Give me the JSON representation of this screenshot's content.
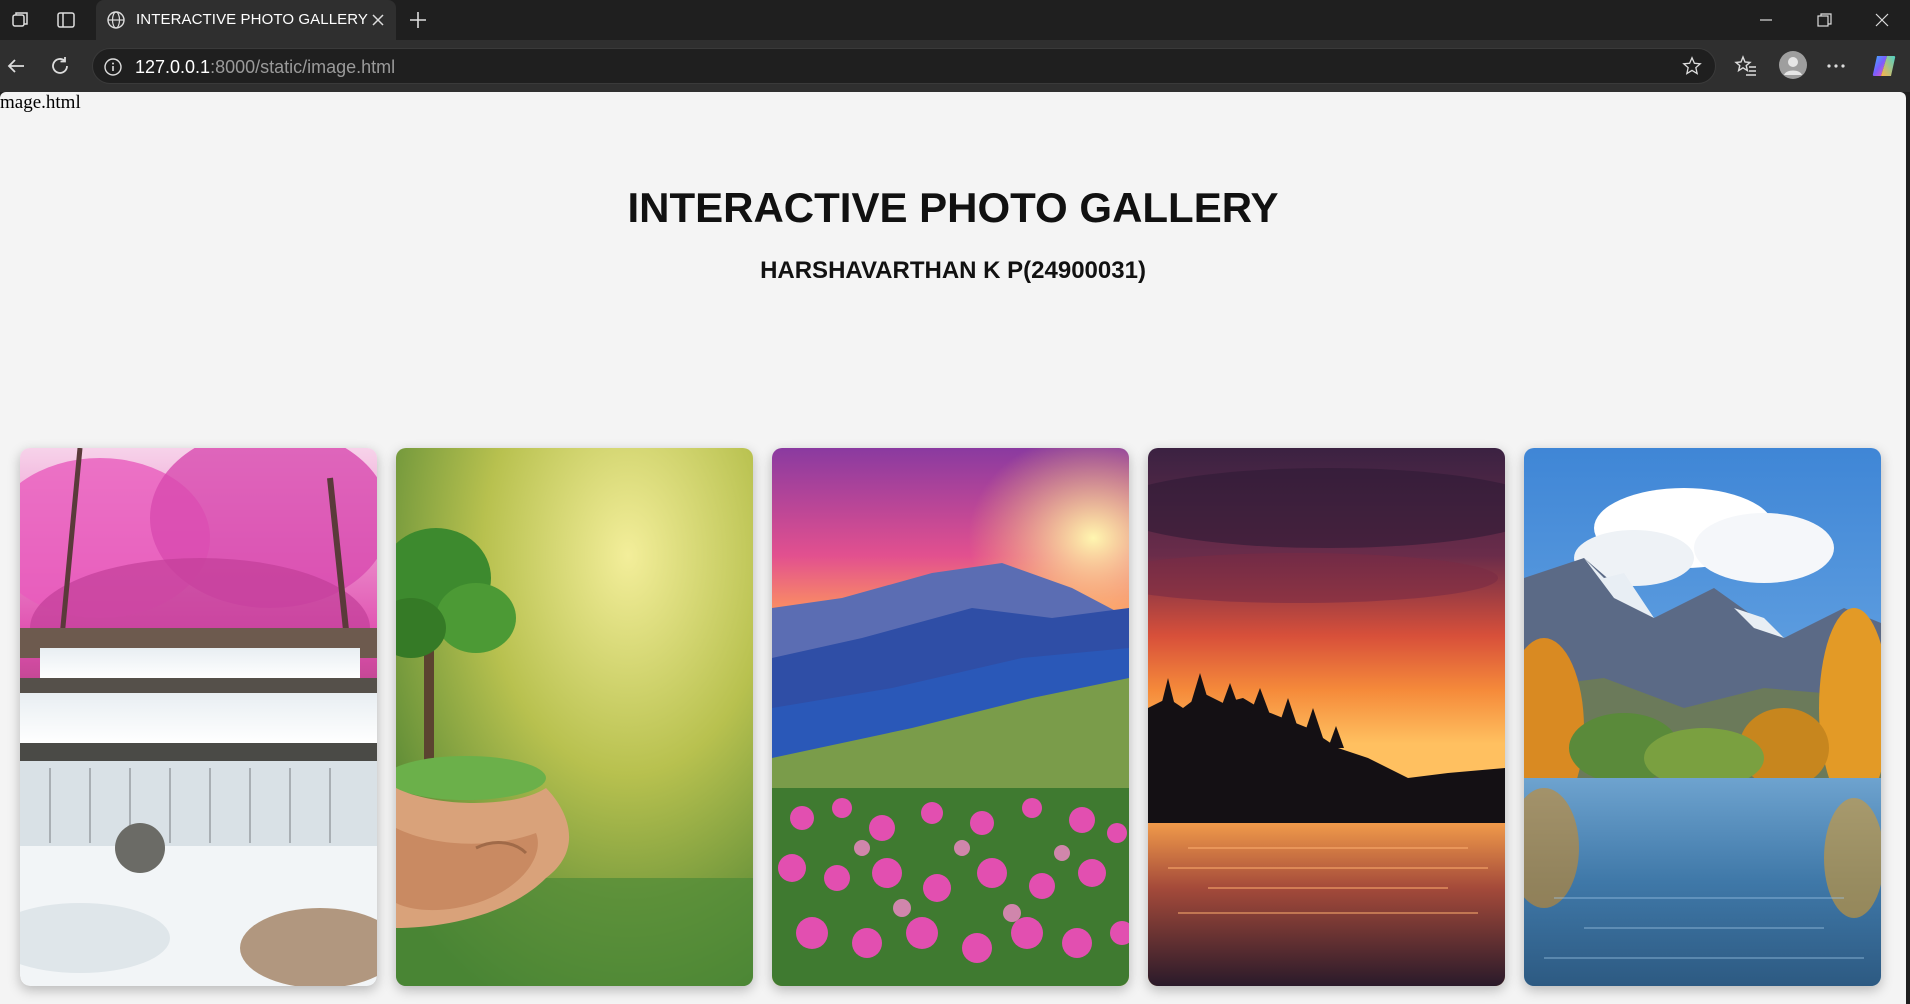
{
  "browser": {
    "tab_title": "INTERACTIVE PHOTO GALLERY",
    "url_host": "127.0.0.1",
    "url_rest": ":8000/static/image.html",
    "icons": [
      "workspaces-icon",
      "tab-actions-icon",
      "globe-icon",
      "close-icon",
      "new-tab-icon",
      "minimize-icon",
      "restore-icon",
      "window-close-icon",
      "back-icon",
      "refresh-icon",
      "info-icon",
      "star-icon",
      "favorites-icon",
      "profile-icon",
      "more-icon",
      "copilot-icon"
    ]
  },
  "page": {
    "file_text": "mage.html",
    "title": "INTERACTIVE PHOTO GALLERY",
    "subtitle": "HARSHAVARTHAN K P(24900031)"
  },
  "gallery": {
    "images": [
      {
        "name": "pink-forest-waterfall"
      },
      {
        "name": "tree-in-hands"
      },
      {
        "name": "mountain-sunset-flowers"
      },
      {
        "name": "lake-sunset"
      },
      {
        "name": "autumn-mountain-lake"
      }
    ]
  },
  "colors": {
    "chrome_dark": "#1f1f1f",
    "chrome_tab": "#2f2f2f",
    "page_bg": "#f4f4f4"
  }
}
